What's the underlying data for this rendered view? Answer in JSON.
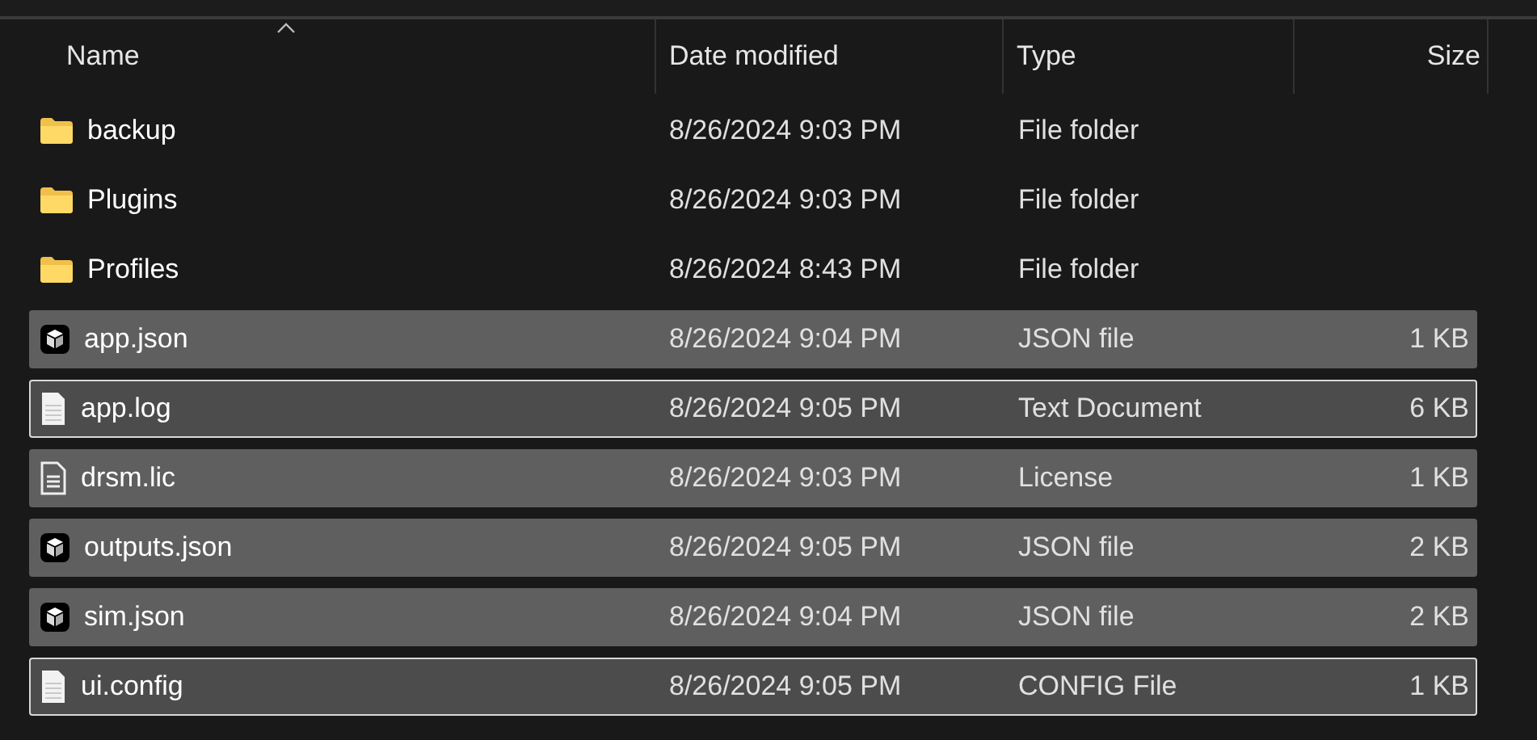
{
  "columns": [
    {
      "label": "Name",
      "sorted": true
    },
    {
      "label": "Date modified",
      "sorted": false
    },
    {
      "label": "Type",
      "sorted": false
    },
    {
      "label": "Size",
      "sorted": false
    }
  ],
  "rows": [
    {
      "kind": "folder",
      "name": "backup",
      "date": "8/26/2024 9:03 PM",
      "type": "File folder",
      "selected": false,
      "outlined": false
    },
    {
      "kind": "folder",
      "name": "Plugins",
      "date": "8/26/2024 9:03 PM",
      "type": "File folder",
      "selected": false,
      "outlined": false
    },
    {
      "kind": "folder",
      "name": "Profiles",
      "date": "8/26/2024 8:43 PM",
      "type": "File folder",
      "selected": false,
      "outlined": false
    },
    {
      "kind": "json",
      "name": "app.json",
      "date": "8/26/2024 9:04 PM",
      "type": "JSON file",
      "size": "1 KB",
      "selected": true,
      "outlined": false
    },
    {
      "kind": "text",
      "name": "app.log",
      "date": "8/26/2024 9:05 PM",
      "type": "Text Document",
      "size": "6 KB",
      "selected": true,
      "outlined": true
    },
    {
      "kind": "license",
      "name": "drsm.lic",
      "date": "8/26/2024 9:03 PM",
      "type": "License",
      "size": "1 KB",
      "selected": true,
      "outlined": false
    },
    {
      "kind": "json",
      "name": "outputs.json",
      "date": "8/26/2024 9:05 PM",
      "type": "JSON file",
      "size": "2 KB",
      "selected": true,
      "outlined": false
    },
    {
      "kind": "json",
      "name": "sim.json",
      "date": "8/26/2024 9:04 PM",
      "type": "JSON file",
      "size": "2 KB",
      "selected": true,
      "outlined": false
    },
    {
      "kind": "text",
      "name": "ui.config",
      "date": "8/26/2024 9:05 PM",
      "type": "CONFIG File",
      "size": "1 KB",
      "selected": true,
      "outlined": true
    }
  ]
}
